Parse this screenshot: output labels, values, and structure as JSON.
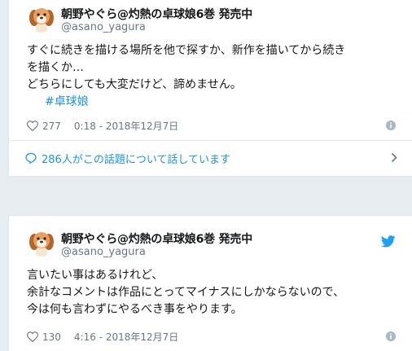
{
  "tweets": [
    {
      "display_name": "朝野やぐら@灼熱の卓球娘6巻 発売中",
      "handle": "@asano_yagura",
      "lines": [
        "すぐに続きを描ける場所を他で探すか、新作を描いてから続き",
        "を描くか…",
        "どちらにしても大変だけど、諦めません。"
      ],
      "hashtag": "#卓球娘",
      "likes": "277",
      "timestamp": "0:18 - 2018年12月7日",
      "conversation": "286人がこの話題について話しています"
    },
    {
      "display_name": "朝野やぐら@灼熱の卓球娘6巻 発売中",
      "handle": "@asano_yagura",
      "lines": [
        "言いたい事はあるけれど、",
        "余計なコメントは作品にとってマイナスにしかならないので、",
        "今は何も言わずにやるべき事をやります。"
      ],
      "likes": "130",
      "timestamp": "4:16 - 2018年12月7日"
    }
  ],
  "icons": {
    "like": "heart-icon",
    "info": "info-icon",
    "reply": "speech-bubble-icon",
    "more": "chevron-right-icon",
    "brand": "twitter-bird-icon"
  },
  "colors": {
    "background": "#e6ecf0",
    "link": "#1b95e0",
    "text": "#14171a",
    "muted": "#657786",
    "brand": "#1da1f2"
  }
}
